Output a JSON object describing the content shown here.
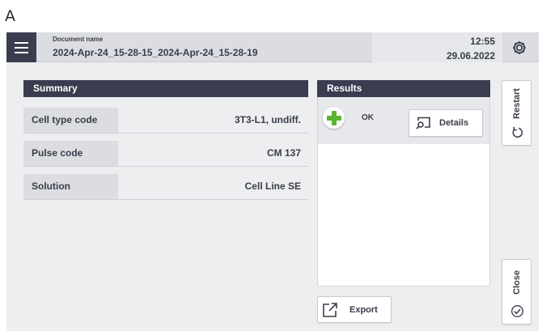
{
  "figure_label": "A",
  "header": {
    "menu_icon": "hamburger-menu-icon",
    "document_caption": "Document name",
    "document_name": "2024-Apr-24_15-28-15_2024-Apr-24_15-28-19",
    "time": "12:55",
    "date": "29.06.2022",
    "settings_icon": "gear-icon"
  },
  "summary": {
    "title": "Summary",
    "rows": [
      {
        "label": "Cell type code",
        "value": "3T3-L1, undiff."
      },
      {
        "label": "Pulse code",
        "value": "CM 137"
      },
      {
        "label": "Solution",
        "value": "Cell Line SE"
      }
    ]
  },
  "results": {
    "title": "Results",
    "items": [
      {
        "status": "OK",
        "status_icon": "plus-icon",
        "details_label": "Details",
        "details_icon": "zoom-window-icon"
      }
    ]
  },
  "actions": {
    "export_label": "Export",
    "export_icon": "export-icon",
    "restart_label": "Restart",
    "restart_icon": "restart-icon",
    "close_label": "Close",
    "close_icon": "check-circle-icon"
  },
  "colors": {
    "header_dark": "#3a3d4f",
    "panel_head": "#3a3d4f",
    "ok_green": "#5cb531",
    "background": "#edeef0"
  }
}
